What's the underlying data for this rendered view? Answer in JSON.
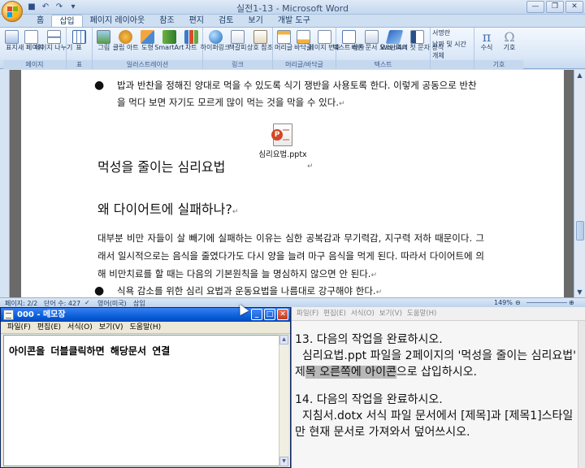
{
  "word": {
    "title": "실전1-13 - Microsoft Word",
    "tabs": [
      {
        "label": "홈",
        "active": false
      },
      {
        "label": "삽입",
        "active": true
      },
      {
        "label": "페이지 레이아웃",
        "active": false
      },
      {
        "label": "참조",
        "active": false
      },
      {
        "label": "편지",
        "active": false
      },
      {
        "label": "검토",
        "active": false
      },
      {
        "label": "보기",
        "active": false
      },
      {
        "label": "개발 도구",
        "active": false
      }
    ],
    "ribbon_groups": [
      {
        "label": "페이지",
        "buttons": [
          "표지",
          "새 페이지",
          "페이지 나누기"
        ]
      },
      {
        "label": "표",
        "buttons": [
          "표"
        ]
      },
      {
        "label": "일러스트레이션",
        "buttons": [
          "그림",
          "클립 아트",
          "도형",
          "SmartArt",
          "차트"
        ]
      },
      {
        "label": "링크",
        "buttons": [
          "하이퍼링크",
          "책갈피",
          "상호 참조"
        ]
      },
      {
        "label": "머리글/바닥글",
        "buttons": [
          "머리글",
          "바닥글",
          "페이지 번호"
        ]
      },
      {
        "label": "텍스트",
        "buttons": [
          "텍스트 상자",
          "빠른 문서 요소",
          "WordArt",
          "단락의 첫 문자 장식"
        ]
      },
      {
        "label": "",
        "small": [
          "서명란",
          "날짜 및 시간",
          "개체"
        ]
      },
      {
        "label": "기호",
        "buttons": [
          "수식",
          "기호"
        ]
      }
    ],
    "doc": {
      "bullet1": "밥과 반찬을 정해진 양대로 먹을 수 있도록 식기 쟁반을 사용토록 한다. 이렇게 공동으로 반찬을 먹다 보면 자기도 모르게 많이 먹는 것을 막을 수 있다.",
      "embedded_name": "심리요법.pptx",
      "heading1": "먹성을 줄이는 심리요법",
      "heading2": "왜 다이어트에 실패하나?",
      "para": "대부분 비만 자들이 살 빼기에 실패하는 이유는 심한 공복감과 무기력감, 지구력 저하 때문이다. 그래서 일시적으로는 음식을 줄였다가도 다시 양을 늘려 마구 음식을 먹게 된다. 따라서 다이어트에 의해 비만치료를 할 때는 다음의 기본원칙을 늘 명심하지 않으면 안 된다.",
      "bullet2": "식욕 감소를 위한 심리 요법과 운동요법을 나름대로 강구해야 한다."
    },
    "status": {
      "page": "페이지: 2/2",
      "words": "단어 수: 427",
      "language": "영어(미국)",
      "mode": "삽입",
      "zoom": "149%"
    }
  },
  "notepad": {
    "title": "000 - 메모장",
    "menu": [
      "파일(F)",
      "편집(E)",
      "서식(O)",
      "보기(V)",
      "도움말(H)"
    ],
    "content": "아이콘을 더블클릭하면 해당문서 연결"
  },
  "instructions": {
    "menu": [
      "파일(F)",
      "편집(E)",
      "서식(O)",
      "보기(V)",
      "도움말(H)"
    ],
    "item13_title": "13. 다음의 작업을 완료하시오.",
    "item13_a": "심리요법.ppt 파일을 2페이지의 '먹성을 줄이는 심리요법' 제",
    "item13_hl": "목 오른쪽에 아이콘",
    "item13_b": "으로 삽입하시오.",
    "item14_title": "14. 다음의 작업을 완료하시오.",
    "item14_body": "지침서.dotx 서식 파일 문서에서 [제목]과 [제목1]스타일만 현재 문서로 가져와서 덮어쓰시오."
  },
  "colors": {
    "ribbon": "#dbe8f7",
    "word_title": "#3b5275",
    "xp_title": "#0a5fd8",
    "highlight": "#b8b8b8"
  }
}
